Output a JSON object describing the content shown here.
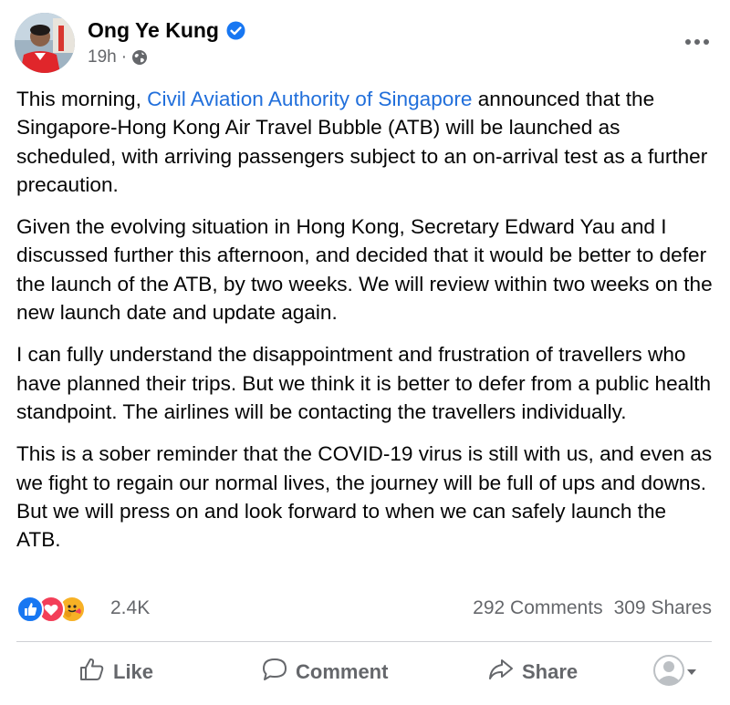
{
  "post": {
    "author": "Ong Ye Kung",
    "timestamp": "19h",
    "visibility_icon": "globe-icon",
    "verified_icon": "verified-badge-icon",
    "more_icon": "more-options-icon",
    "paragraphs": {
      "p1": {
        "before": "This morning, ",
        "link": "Civil Aviation Authority of Singapore",
        "after": " announced that the Singapore-Hong Kong Air Travel Bubble (ATB) will be launched as scheduled, with arriving passengers subject to an on-arrival test as a further precaution."
      },
      "p2": "Given the evolving situation in Hong Kong, Secretary Edward Yau and I discussed further this afternoon, and decided that it would be better to defer the launch of the ATB, by two weeks. We will review within two weeks on the new launch date and update again.",
      "p3": "I can fully understand the disappointment and frustration of travellers who have planned their trips. But we think it is better to defer from a public health standpoint. The airlines will be contacting the travellers individually.",
      "p4": "This is a sober reminder that the COVID-19 virus is still with us, and even as we fight to regain our normal lives, the journey will be full of ups and downs. But we will press on and look forward to when we can safely launch the ATB."
    }
  },
  "engagement": {
    "reaction_icons": [
      "like-reaction-icon",
      "love-reaction-icon",
      "care-reaction-icon"
    ],
    "reaction_count": "2.4K",
    "comments": "292 Comments",
    "shares": "309 Shares"
  },
  "actions": {
    "like_label": "Like",
    "comment_label": "Comment",
    "share_label": "Share"
  },
  "colors": {
    "link": "#216fdb",
    "secondary_text": "#65676b",
    "like_blue": "#1877f2",
    "love_red": "#f33e58",
    "care_yellow": "#f7b125"
  }
}
